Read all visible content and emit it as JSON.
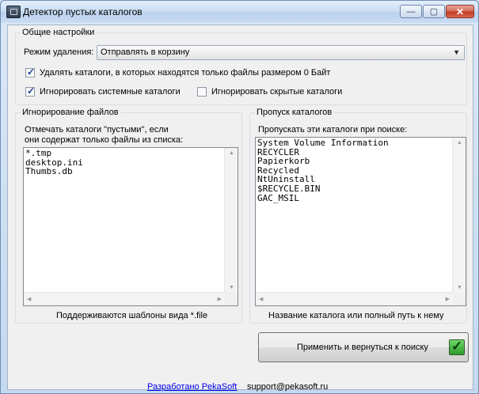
{
  "window": {
    "title": "Детектор пустых каталогов",
    "buttons": {
      "minimize": "—",
      "maximize": "▢",
      "close": "✕"
    }
  },
  "general": {
    "legend": "Общие настройки",
    "mode_label": "Режим удаления:",
    "mode_value": "Отправлять в корзину",
    "cb_zero_files": {
      "label": "Удалять каталоги, в которых находятся только файлы размером 0 Байт",
      "checked": true
    },
    "cb_ignore_system": {
      "label": "Игнорировать системные каталоги",
      "checked": true
    },
    "cb_ignore_hidden": {
      "label": "Игнорировать скрытые каталоги",
      "checked": false
    }
  },
  "ignore_files": {
    "legend": "Игнорирование файлов",
    "desc_line1": "Отмечать каталоги \"пустыми\", если",
    "desc_line2": "они содержат только файлы из списка:",
    "items": [
      "*.tmp",
      "desktop.ini",
      "Thumbs.db"
    ],
    "footer": "Поддерживаются шаблоны вида *.file"
  },
  "skip_dirs": {
    "legend": "Пропуск каталогов",
    "desc": "Пропускать эти каталоги при поиске:",
    "items": [
      "System Volume Information",
      "RECYCLER",
      "Papierkorb",
      "Recycled",
      "NtUninstall",
      "$RECYCLE.BIN",
      "GAC_MSIL"
    ],
    "footer": "Название каталога или полный путь к нему"
  },
  "apply_button": "Применить и вернуться к поиску",
  "footer": {
    "link": "Разработано PekaSoft",
    "email": "support@pekasoft.ru"
  }
}
